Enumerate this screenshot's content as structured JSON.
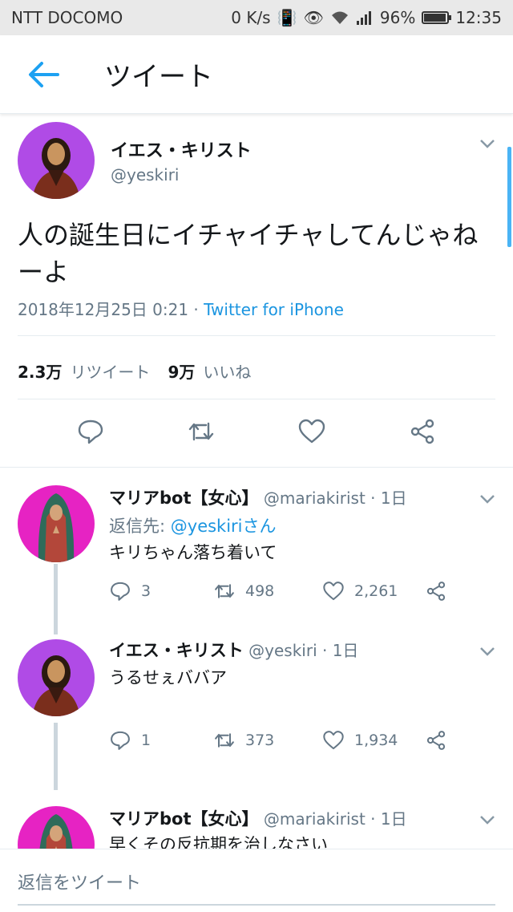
{
  "status": {
    "carrier": "NTT DOCOMO",
    "speed": "0 K/s",
    "battery": "96%",
    "time": "12:35"
  },
  "header": {
    "title": "ツイート"
  },
  "tweet": {
    "name": "イエス・キリスト",
    "handle": "@yeskiri",
    "text": "人の誕生日にイチャイチャしてんじゃねーよ",
    "date": "2018年12月25日 0:21 · ",
    "source": "Twitter for iPhone",
    "retweets": "2.3万",
    "retweets_label": "リツイート",
    "likes": "9万",
    "likes_label": "いいね"
  },
  "replies": [
    {
      "name": "マリアbot【女心】",
      "handle": "@mariakirist · 1日",
      "reply_to_label": "返信先: ",
      "reply_to": "@yeskiriさん",
      "text": "キリちゃん落ち着いて",
      "replies": "3",
      "retweets": "498",
      "likes": "2,261"
    },
    {
      "name": "イエス・キリスト",
      "handle": "@yeskiri · 1日",
      "text": "うるせぇババア",
      "replies": "1",
      "retweets": "373",
      "likes": "1,934"
    },
    {
      "name": "マリアbot【女心】",
      "handle": "@mariakirist · 1日",
      "text": "早くその反抗期を治しなさい"
    }
  ],
  "compose": {
    "placeholder": "返信をツイート"
  },
  "colors": {
    "accent": "#1da1f2",
    "jesus_avatar_bg": "#b04be6",
    "maria_avatar_bg": "#e623c3"
  }
}
